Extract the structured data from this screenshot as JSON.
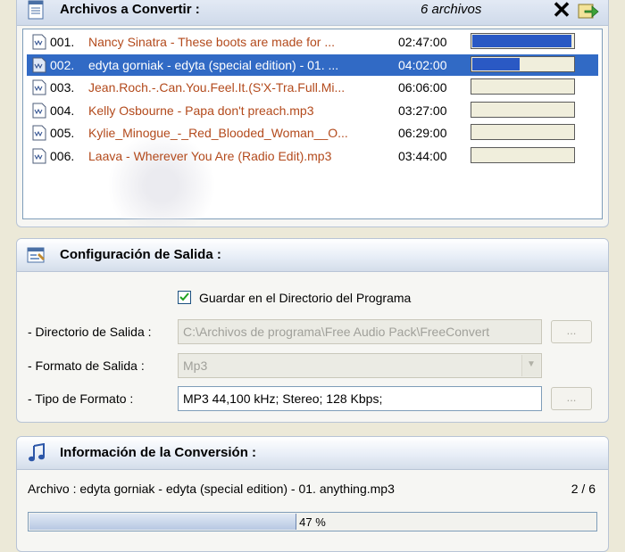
{
  "files_panel": {
    "title": "Archivos a Convertir :",
    "file_count": "6 archivos",
    "files": [
      {
        "num": "001.",
        "name": "Nancy Sinatra - These boots are made for ...",
        "duration": "02:47:00",
        "progress": 0.98,
        "selected": false
      },
      {
        "num": "002.",
        "name": "edyta gorniak - edyta (special edition) - 01. ...",
        "duration": "04:02:00",
        "progress": 0.47,
        "selected": true
      },
      {
        "num": "003.",
        "name": "Jean.Roch.-.Can.You.Feel.It.(S'X-Tra.Full.Mi...",
        "duration": "06:06:00",
        "progress": 0,
        "selected": false
      },
      {
        "num": "004.",
        "name": "Kelly Osbourne - Papa don't preach.mp3",
        "duration": "03:27:00",
        "progress": 0,
        "selected": false
      },
      {
        "num": "005.",
        "name": "Kylie_Minogue_-_Red_Blooded_Woman__O...",
        "duration": "06:29:00",
        "progress": 0,
        "selected": false
      },
      {
        "num": "006.",
        "name": "Laava - Wherever You Are (Radio Edit).mp3",
        "duration": "03:44:00",
        "progress": 0,
        "selected": false
      }
    ]
  },
  "config_panel": {
    "title": "Configuración de Salida :",
    "save_in_program_dir_label": "Guardar en el Directorio del Programa",
    "save_in_program_dir_checked": true,
    "output_dir_label": "- Directorio de Salida :",
    "output_dir_value": "C:\\Archivos de programa\\Free Audio Pack\\FreeConvert",
    "output_format_label": "- Formato de Salida :",
    "output_format_value": "Mp3",
    "format_type_label": "- Tipo de Formato :",
    "format_type_value": "MP3 44,100 kHz; Stereo;  128 Kbps;",
    "browse_label": "..."
  },
  "info_panel": {
    "title": "Información de la Conversión :",
    "current_file": "Archivo : edyta gorniak - edyta (special edition) - 01. anything.mp3",
    "counter": "2 / 6",
    "progress_percent": 47,
    "progress_text": "47 %"
  },
  "colors": {
    "selection": "#316ac5",
    "file_name": "#b34a1c",
    "progress_fill": "#2a59c4"
  }
}
